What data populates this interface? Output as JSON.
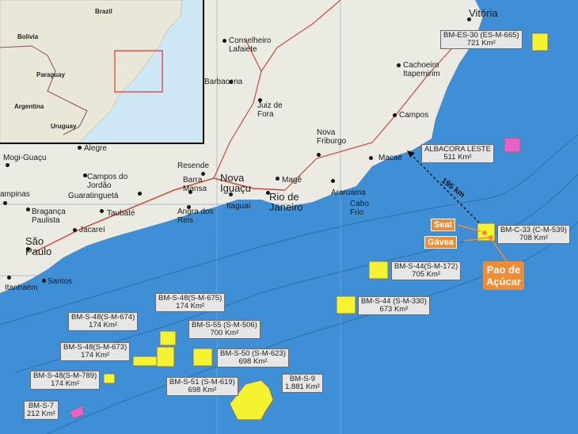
{
  "inset": {
    "labels": [
      "Brazil",
      "Bolivia",
      "Paraguay",
      "Argentina",
      "Uruguay"
    ]
  },
  "cities": {
    "vitoria": "Vitória",
    "conselheiro": "Conselheiro Lafaiete",
    "cachoeiro": "Cachoeiro Itapemirim",
    "barbacena": "Barbacena",
    "juiz": "Juiz de Fora",
    "campos": "Campos",
    "nova_friburgo": "Nova Friburgo",
    "macae": "Macaé",
    "alegre": "Alegre",
    "mogi": "Mogi-Guaçu",
    "campos_jordao": "Campos do Jordão",
    "resende": "Resende",
    "guaratingueta": "Guaratinguetá",
    "barra_mansa": "Barra Mansa",
    "nova_iguacu": "Nova Iguaçu",
    "itaguai": "Itaguaí",
    "mage": "Magé",
    "rio": "Rio de Janeiro",
    "araruama": "Araruama",
    "cabo_frio": "Cabo Frio",
    "campinas": "ampinas",
    "braganca": "Bragança Paulista",
    "taubate": "Taubaté",
    "angra": "Angra dos Reis",
    "jacarei": "Jacareí",
    "sao_paulo": "São Paulo",
    "santos": "Santos",
    "itanhaem": "Itanhaém"
  },
  "blocks": {
    "bm_es_30": {
      "name": "BM-ES-30 (ES-M-665)",
      "area": "721 Km²"
    },
    "albacora": {
      "name": "ALBACORA LESTE",
      "area": "511 Km²"
    },
    "bm_c_33": {
      "name": "BM-C-33 (C-M-539)",
      "area": "708 Km²"
    },
    "bm_s_44_172": {
      "name": "BM-S-44(S-M-172)",
      "area": "705 Km²"
    },
    "bm_s_44_330": {
      "name": "BM-S-44 (S-M-330)",
      "area": "673 Km²"
    },
    "bm_s_48_675": {
      "name": "BM-S-48(S-M-675)",
      "area": "174 Km²"
    },
    "bm_s_48_674": {
      "name": "BM-S-48(S-M-674)",
      "area": "174 Km²"
    },
    "bm_s_55": {
      "name": "BM-S-55 (S-M-506)",
      "area": "700 Km²"
    },
    "bm_s_48_673": {
      "name": "BM-S-48(S-M-673)",
      "area": "174 Km²"
    },
    "bm_s_50": {
      "name": "BM-S-50 (S-M-623)",
      "area": "698 Km²"
    },
    "bm_s_48_789": {
      "name": "BM-S-48(S-M-789)",
      "area": "174 Km²"
    },
    "bm_s_51": {
      "name": "BM-S-51 (S-M-619)",
      "area": "698 Km²"
    },
    "bm_s_9": {
      "name": "BM-S-9",
      "area": "1.881 Km²"
    },
    "bm_s_7": {
      "name": "BM-S-7",
      "area": "212 Km²"
    }
  },
  "callouts": {
    "seat": "Seat",
    "gavea": "Gávea",
    "pao_line1": "Pao de",
    "pao_line2": "Açúcar",
    "distance": "195 km"
  },
  "colors": {
    "ocean": "#3e8fd6",
    "land": "#ecebe3",
    "block_yellow": "#f5f230",
    "block_pink": "#e860c8",
    "callout_orange": "#f08c33"
  }
}
